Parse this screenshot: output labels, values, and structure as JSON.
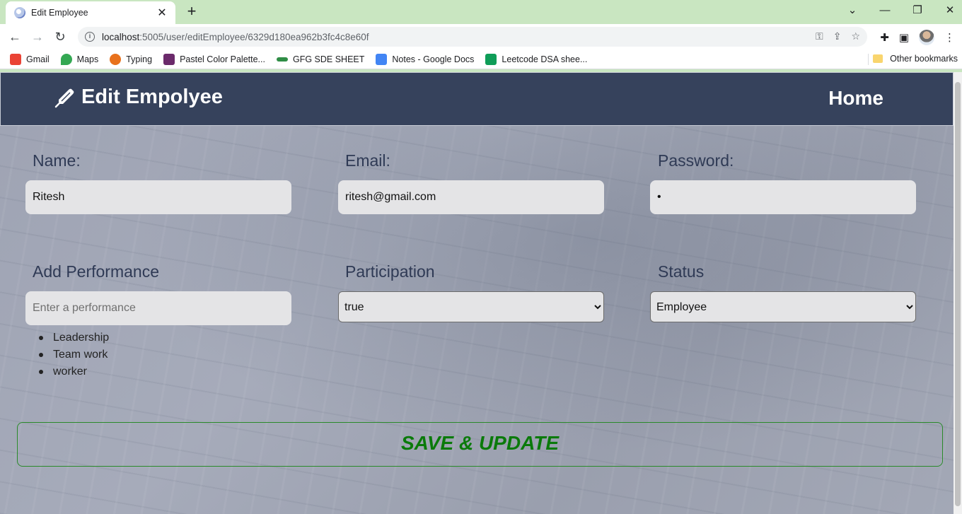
{
  "browser": {
    "tab_title": "Edit Employee",
    "url_host": "localhost",
    "url_rest": ":5005/user/editEmployee/6329d180ea962b3fc4c8e60f",
    "bookmarks": [
      {
        "label": "Gmail",
        "color": "#ea4335"
      },
      {
        "label": "Maps",
        "color": "#34a853"
      },
      {
        "label": "Typing",
        "color": "#e8711c"
      },
      {
        "label": "Pastel Color Palette...",
        "color": "#6b2a6b"
      },
      {
        "label": "GFG SDE SHEET",
        "color": "#2f8d46"
      },
      {
        "label": "Notes - Google Docs",
        "color": "#4285f4"
      },
      {
        "label": "Leetcode DSA shee...",
        "color": "#0f9d58"
      }
    ],
    "other_bookmarks": "Other bookmarks"
  },
  "navbar": {
    "brand": "Edit Empolyee",
    "home": "Home",
    "bg_color": "#36425c"
  },
  "form": {
    "name_label": "Name:",
    "name_value": "Ritesh",
    "email_label": "Email:",
    "email_value": "ritesh@gmail.com",
    "password_label": "Password:",
    "password_value": "•",
    "performance_label": "Add Performance",
    "performance_placeholder": "Enter a performance",
    "participation_label": "Participation",
    "participation_value": "true",
    "status_label": "Status",
    "status_value": "Employee",
    "performances": [
      "Leadership",
      "Team work",
      "worker"
    ],
    "save_label": "SAVE & UPDATE",
    "save_color": "#0a7a0a"
  }
}
